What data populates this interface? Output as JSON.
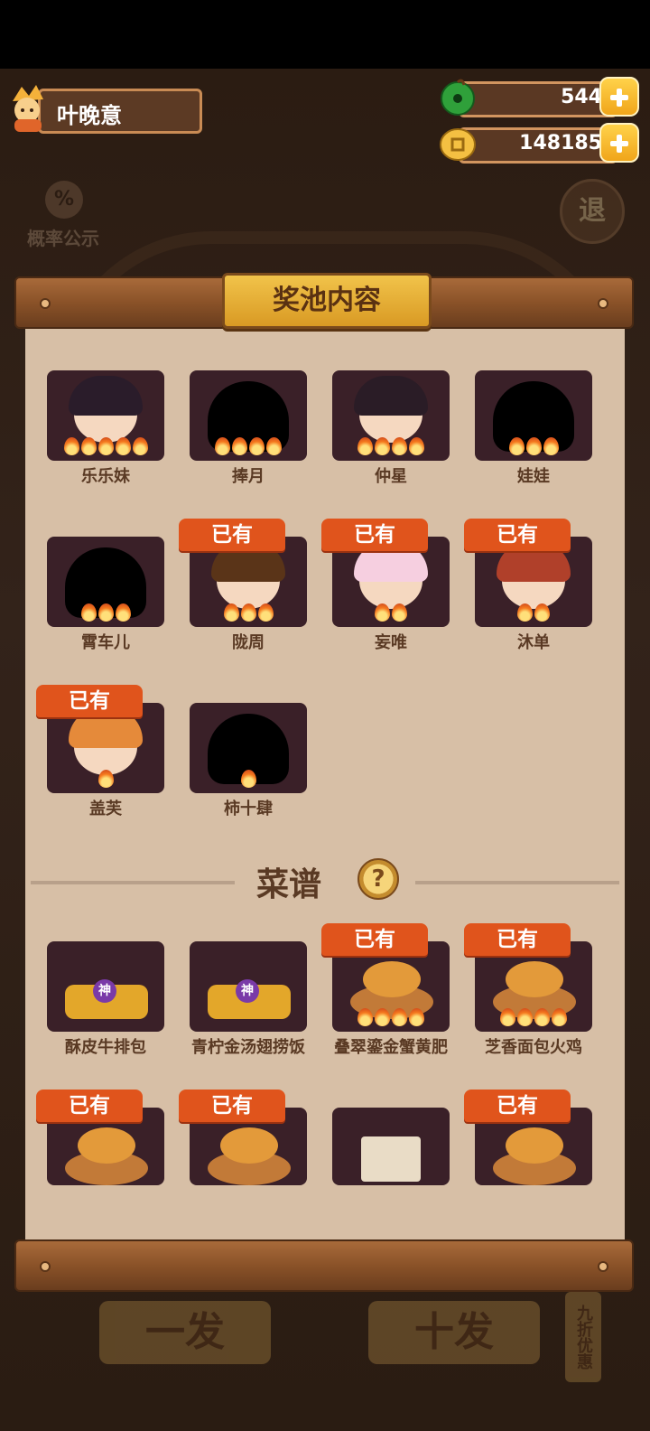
{
  "player": {
    "name": "叶晚意"
  },
  "currency": {
    "jade": "544",
    "coins": "148185"
  },
  "background": {
    "probability_label": "概率公示",
    "exit_label": "退",
    "single_draw": "一发",
    "ten_draw": "十发",
    "discount": "九折优惠"
  },
  "panel": {
    "title": "奖池内容"
  },
  "owned_label": "已有",
  "characters": [
    {
      "name": "乐乐妹",
      "owned": false,
      "stars": 5,
      "silhouette": false,
      "hair": "#2a1c2a"
    },
    {
      "name": "捧月",
      "owned": false,
      "stars": 4,
      "silhouette": true
    },
    {
      "name": "仲星",
      "owned": false,
      "stars": 4,
      "silhouette": false,
      "hair": "#2a1c26"
    },
    {
      "name": "娃娃",
      "owned": false,
      "stars": 3,
      "silhouette": true
    },
    {
      "name": "霄车儿",
      "owned": false,
      "stars": 3,
      "silhouette": true
    },
    {
      "name": "陇周",
      "owned": true,
      "stars": 3,
      "silhouette": false,
      "hair": "#5a3418"
    },
    {
      "name": "妄唯",
      "owned": true,
      "stars": 2,
      "silhouette": false,
      "hair": "#f6cfe0"
    },
    {
      "name": "沐单",
      "owned": true,
      "stars": 2,
      "silhouette": false,
      "hair": "#b0402a"
    },
    {
      "name": "盖芙",
      "owned": true,
      "stars": 1,
      "silhouette": false,
      "hair": "#e58a3a"
    },
    {
      "name": "柿十肆",
      "owned": false,
      "stars": 1,
      "silhouette": true
    }
  ],
  "recipes": {
    "title": "菜谱",
    "help": "?",
    "items": [
      {
        "name": "酥皮牛排包",
        "owned": false,
        "stars": 0,
        "badge": "神"
      },
      {
        "name": "青柠金汤翅捞饭",
        "owned": false,
        "stars": 0,
        "badge": "神"
      },
      {
        "name": "叠翠鎏金蟹黄肥",
        "owned": true,
        "stars": 4,
        "badge": ""
      },
      {
        "name": "芝香面包火鸡",
        "owned": true,
        "stars": 4,
        "badge": ""
      },
      {
        "name": "",
        "owned": true,
        "stars": 0,
        "badge": ""
      },
      {
        "name": "",
        "owned": true,
        "stars": 0,
        "badge": ""
      },
      {
        "name": "",
        "owned": false,
        "stars": 0,
        "badge": ""
      },
      {
        "name": "",
        "owned": true,
        "stars": 0,
        "badge": ""
      }
    ]
  },
  "colors": {
    "owned_tag": "#e0541c",
    "card_bg": "#3a2028",
    "paper": "#d7bfa6",
    "plaque": "#f1c34a"
  }
}
